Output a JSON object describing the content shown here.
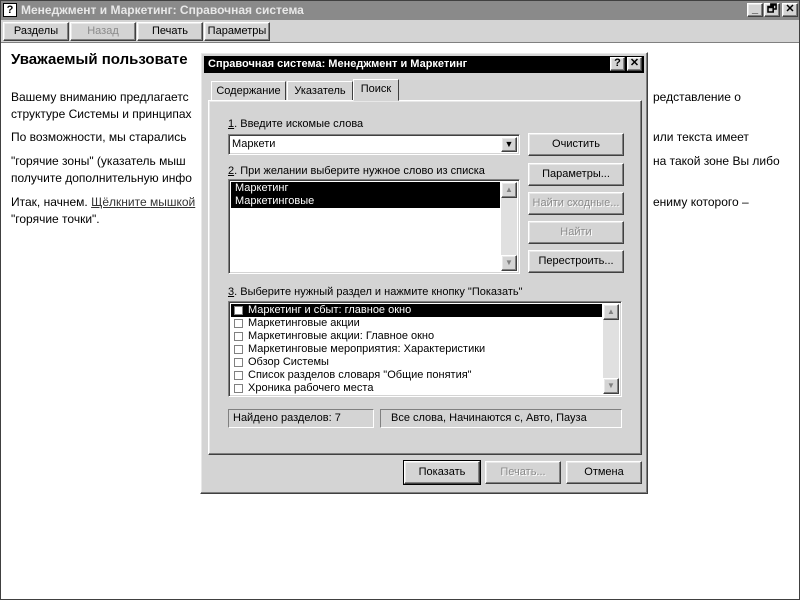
{
  "window": {
    "title": "Менеджмент и Маркетинг: Справочная система",
    "icon": "?",
    "controls": [
      "_",
      "🗗",
      "✕"
    ]
  },
  "toolbar": {
    "buttons": [
      {
        "label": "Разделы",
        "enabled": true
      },
      {
        "label": "Назад",
        "enabled": false
      },
      {
        "label": "Печать",
        "enabled": true
      },
      {
        "label": "Параметры",
        "enabled": true
      }
    ]
  },
  "topic": {
    "title": "Уважаемый пользовате",
    "p1_left": "Вашему вниманию предлагаетс",
    "p1_right": "редставление о",
    "p1b_left": "структуре Системы и принципах",
    "p2_left": "По возможности, мы старались",
    "p2_right": "или текста имеет",
    "p3_left": "\"горячие зоны\" (указатель мыш",
    "p3_right": "на такой зоне Вы либо",
    "p3b_left": "получите дополнительную инфо",
    "p4_prefix": "Итак, начнем. ",
    "p4_link": "Щёлкните мышкой",
    "p4_right": "ениму которого –",
    "p4b_left": "\"горячие точки\"."
  },
  "dialog": {
    "title": "Справочная система: Менеджмент и Маркетинг",
    "help_btn": "?",
    "close_btn": "✕",
    "tabs": [
      {
        "label": "Содержание",
        "active": false
      },
      {
        "label": "Указатель",
        "active": false
      },
      {
        "label": "Поиск",
        "active": true
      }
    ],
    "step1_num": "1",
    "step1_label": ". Введите искомые слова",
    "search_value": "Маркети",
    "step2_num": "2",
    "step2_label": ". При желании выберите нужное слово из списка",
    "words": [
      {
        "text": "Маркетинг",
        "selected": true
      },
      {
        "text": "Маркетинговые",
        "selected": true
      }
    ],
    "step3_num": "3",
    "step3_label": ". Выберите нужный раздел и нажмите кнопку \"Показать\"",
    "topics": [
      {
        "text": "Маркетинг и сбыт: главное окно",
        "selected": true
      },
      {
        "text": "Маркетинговые акции",
        "selected": false
      },
      {
        "text": "Маркетинговые акции: Главное окно",
        "selected": false
      },
      {
        "text": "Маркетинговые мероприятия: Характеристики",
        "selected": false
      },
      {
        "text": "Обзор Системы",
        "selected": false
      },
      {
        "text": "Список разделов словаря \"Общие понятия\"",
        "selected": false
      },
      {
        "text": "Хроника рабочего места",
        "selected": false
      }
    ],
    "buttons": {
      "clear": "Очистить",
      "options": "Параметры...",
      "find_similar": "Найти сходные...",
      "find": "Найти",
      "rebuild": "Перестроить..."
    },
    "status_found": "Найдено разделов: 7",
    "status_options": "Все слова, Начинаются с, Авто, Пауза",
    "footer": {
      "show": "Показать",
      "print": "Печать...",
      "cancel": "Отмена"
    }
  }
}
